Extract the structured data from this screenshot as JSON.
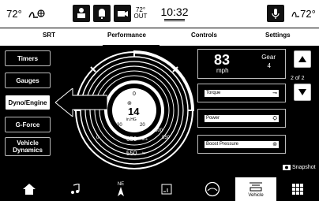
{
  "status_bar": {
    "temp_left": "72°",
    "outside_temp": "72°",
    "outside_label": "OUT",
    "clock": "10:32",
    "temp_right": "72°"
  },
  "tabs": [
    "SRT",
    "Performance",
    "Controls",
    "Settings"
  ],
  "active_tab": "Performance",
  "side_menu": [
    "Timers",
    "Gauges",
    "Dyno/Engine",
    "G-Force",
    "Vehicle Dynamics"
  ],
  "active_side": "Dyno/Engine",
  "gauge": {
    "center_value": "14",
    "center_unit": "in.HG",
    "scale_left": "-30",
    "scale_left2": "20",
    "scale_right": "800",
    "tick_0": "0",
    "value_650": "650",
    "unit_lbft": "lb-ft",
    "value_850": "850",
    "value_550": "550",
    "unit_hp": "hp"
  },
  "speed_tile": {
    "speed": "83",
    "unit": "mph",
    "gear_label": "Gear",
    "gear_value": "4"
  },
  "bars": [
    "Torque",
    "Power",
    "Boost Pressure"
  ],
  "pagination": "2 of 2",
  "snapshot": "Snapshot",
  "bottom_nav": {
    "vehicle_label": "Vehicle",
    "compass": "NE"
  }
}
